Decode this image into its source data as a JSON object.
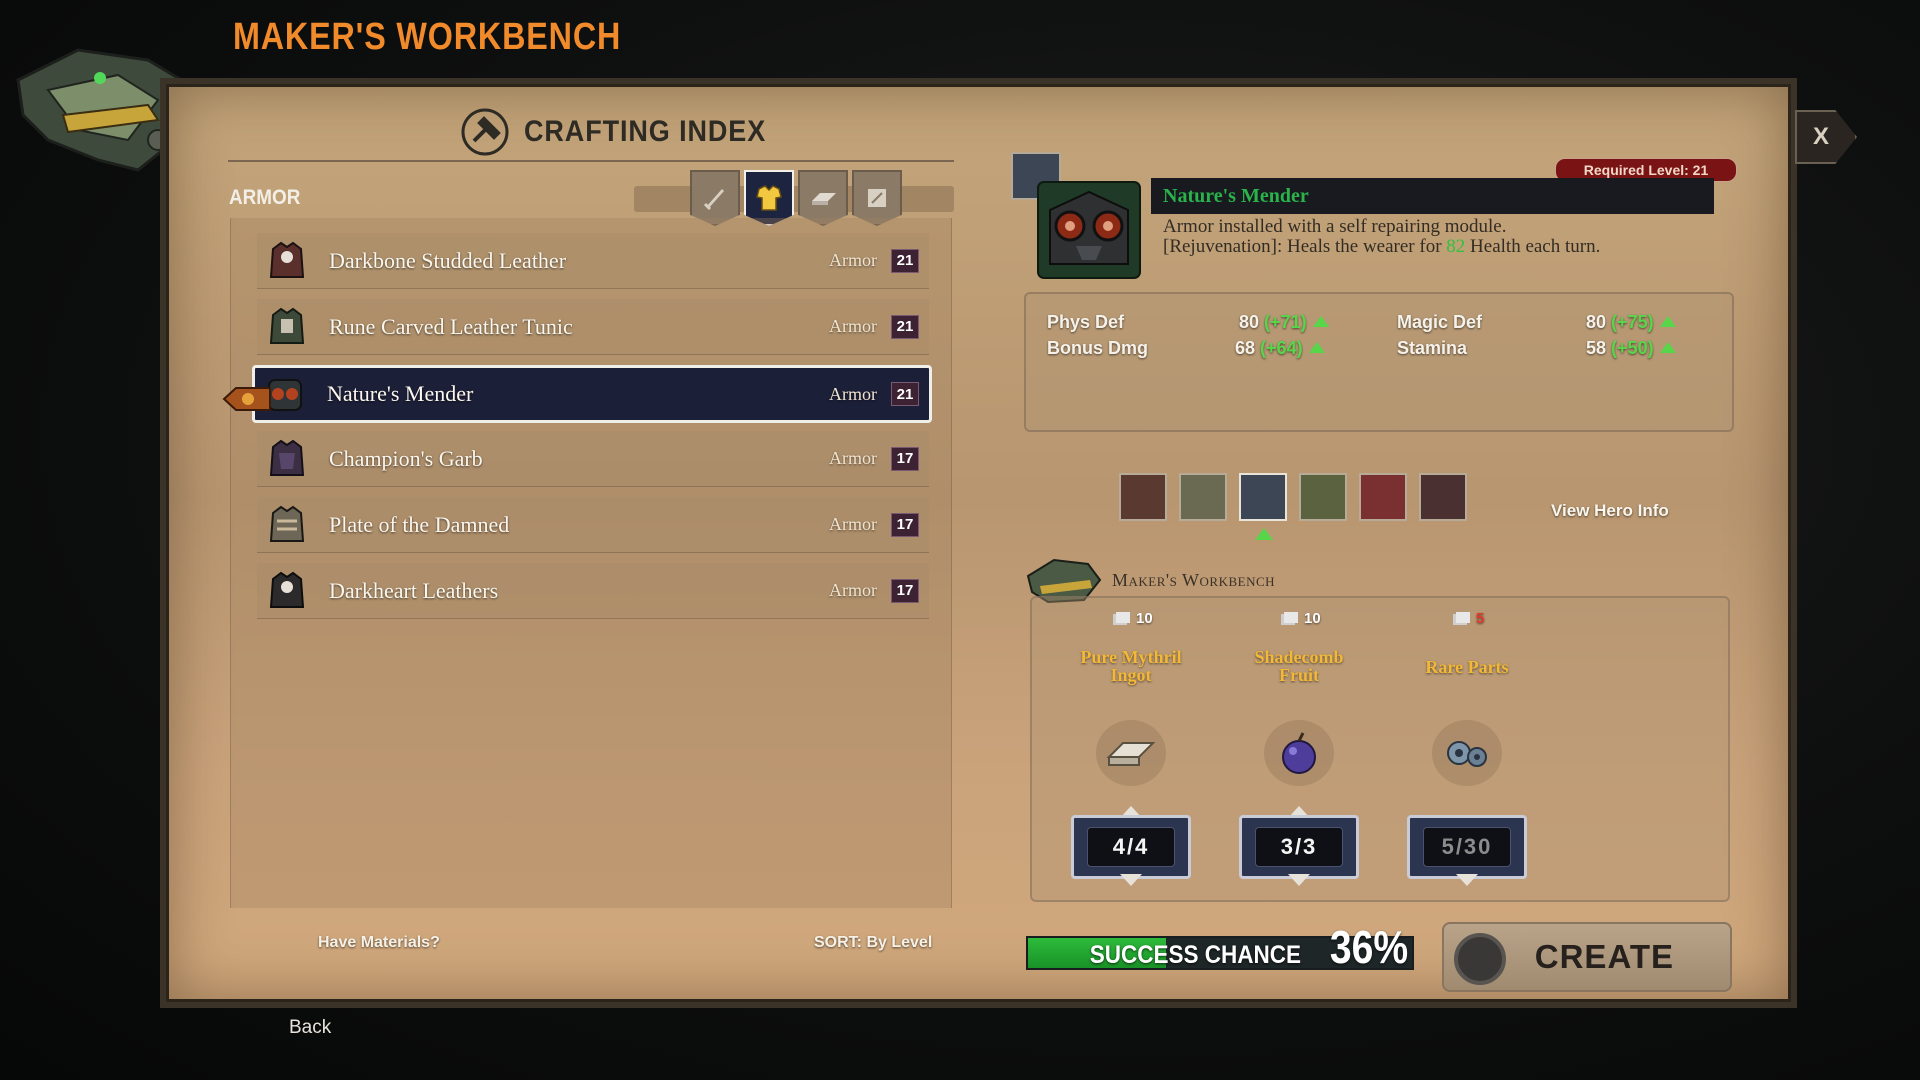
{
  "header": {
    "title": "MAKER'S WORKBENCH",
    "close_label": "X"
  },
  "crafting": {
    "title": "CRAFTING INDEX",
    "category": "ARMOR",
    "filters": [
      {
        "name": "weapon",
        "icon": "sword-icon"
      },
      {
        "name": "armor",
        "icon": "chestplate-icon",
        "active": true
      },
      {
        "name": "material",
        "icon": "ingot-icon"
      },
      {
        "name": "document",
        "icon": "scroll-icon"
      }
    ],
    "items": [
      {
        "name": "Darkbone Studded Leather",
        "type": "Armor",
        "level": "21"
      },
      {
        "name": "Rune Carved Leather Tunic",
        "type": "Armor",
        "level": "21"
      },
      {
        "name": "Nature's Mender",
        "type": "Armor",
        "level": "21",
        "selected": true
      },
      {
        "name": "Champion's Garb",
        "type": "Armor",
        "level": "17"
      },
      {
        "name": "Plate of the Damned",
        "type": "Armor",
        "level": "17"
      },
      {
        "name": "Darkheart Leathers",
        "type": "Armor",
        "level": "17"
      }
    ],
    "have_materials": "Have Materials?",
    "sort": "SORT: By Level"
  },
  "detail": {
    "required_level": "Required Level: 21",
    "name": "Nature's Mender",
    "desc_line1": "Armor installed with a self repairing module.",
    "desc_line2_pre": "[Rejuvenation]: Heals the wearer for ",
    "desc_line2_value": "82",
    "desc_line2_post": " Health each turn.",
    "stats": [
      {
        "label": "Phys Def",
        "value": "80",
        "bonus": "(+71)"
      },
      {
        "label": "Magic Def",
        "value": "80",
        "bonus": "(+75)"
      },
      {
        "label": "Bonus Dmg",
        "value": "68",
        "bonus": "(+64)"
      },
      {
        "label": "Stamina",
        "value": "58",
        "bonus": "(+50)"
      }
    ],
    "view_hero_info": "View Hero Info"
  },
  "workbench": {
    "label": "Maker's Workbench",
    "materials": [
      {
        "name_line1": "Pure Mythril",
        "name_line2": "Ingot",
        "have": "10",
        "qty": "4/4",
        "icon": "ingot-icon"
      },
      {
        "name_line1": "Shadecomb",
        "name_line2": "Fruit",
        "have": "10",
        "qty": "3/3",
        "icon": "fruit-icon"
      },
      {
        "name_line1": "Rare Parts",
        "name_line2": "",
        "have": "5",
        "have_low": true,
        "qty": "5/30",
        "icon": "gears-icon"
      }
    ]
  },
  "craft": {
    "success_label": "SUCCESS CHANCE",
    "success_pct": "36%",
    "success_value": 0.36,
    "create_label": "CREATE"
  },
  "footer": {
    "back": "Back"
  },
  "colors": {
    "title_orange": "#f08a2a",
    "stat_green": "#58d64a",
    "name_green": "#29b34a",
    "req_red": "#7a1414",
    "gold_text": "#f3b835"
  }
}
